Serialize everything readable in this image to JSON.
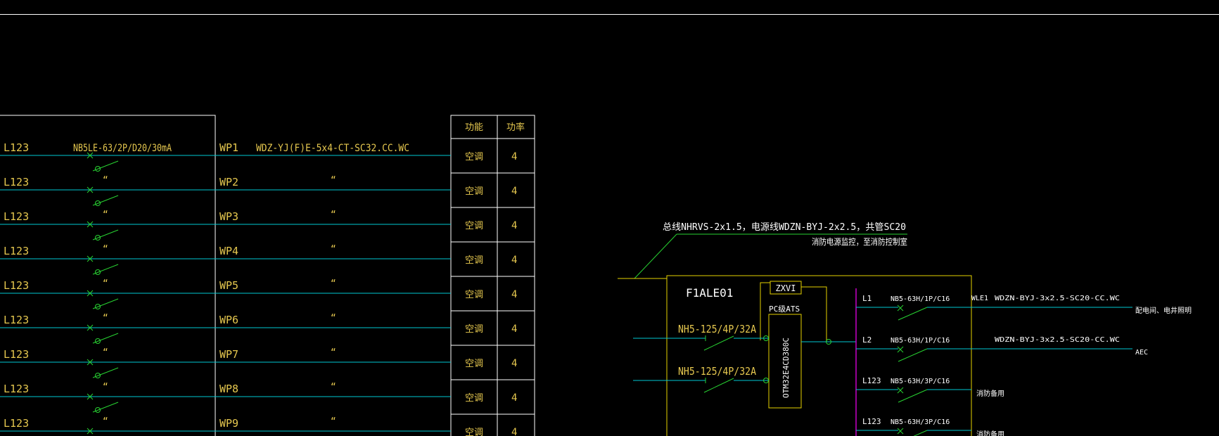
{
  "colors": {
    "background": "#000000",
    "frame": "#ffffff",
    "text": "#e6c84f",
    "feeder": "#00c8d2",
    "switch": "#28d232",
    "panel": "#e6d200",
    "bus": "#c800c8"
  },
  "left_panel": {
    "breaker_spec": "NB5LE-63/2P/D20/30mA",
    "cable_spec": "WDZ-YJ(F)E-5x4-CT-SC32.CC.WC",
    "ditto_mark": "“",
    "rows": [
      {
        "phase": "L123",
        "circuit": "WP1"
      },
      {
        "phase": "L123",
        "circuit": "WP2"
      },
      {
        "phase": "L123",
        "circuit": "WP3"
      },
      {
        "phase": "L123",
        "circuit": "WP4"
      },
      {
        "phase": "L123",
        "circuit": "WP5"
      },
      {
        "phase": "L123",
        "circuit": "WP6"
      },
      {
        "phase": "L123",
        "circuit": "WP7"
      },
      {
        "phase": "L123",
        "circuit": "WP8"
      },
      {
        "phase": "L123",
        "circuit": "WP9"
      }
    ],
    "load_table": {
      "headers": [
        "功能",
        "功率"
      ],
      "rows": [
        {
          "function": "空调",
          "power": "4"
        },
        {
          "function": "空调",
          "power": "4"
        },
        {
          "function": "空调",
          "power": "4"
        },
        {
          "function": "空调",
          "power": "4"
        },
        {
          "function": "空调",
          "power": "4"
        },
        {
          "function": "空调",
          "power": "4"
        },
        {
          "function": "空调",
          "power": "4"
        },
        {
          "function": "空调",
          "power": "4"
        },
        {
          "function": "空调",
          "power": "4"
        }
      ]
    }
  },
  "right_panel": {
    "monitor_note_1": "总线NHRVS-2x1.5，电源线WDZN-BYJ-2x2.5，共管SC20",
    "monitor_note_2": "消防电源监控，至消防控制室",
    "panel_name": "F1ALE01",
    "zxvi_label": "ZXVI",
    "ats_label": "PC级ATS",
    "ats_model": "OTM32E4CD380C",
    "incoming": [
      {
        "breaker": "NH5-125/4P/32A"
      },
      {
        "breaker": "NH5-125/4P/32A"
      }
    ],
    "outgoing": [
      {
        "phase": "L1",
        "breaker": "NB5-63H/1P/C16",
        "circuit": "WLE1",
        "cable": "WDZN-BYJ-3x2.5-SC20-CC.WC",
        "load": "配电间、电井照明"
      },
      {
        "phase": "L2",
        "breaker": "NB5-63H/1P/C16",
        "circuit": "",
        "cable": "WDZN-BYJ-3x2.5-SC20-CC.WC",
        "load": "AEC"
      },
      {
        "phase": "L123",
        "breaker": "NB5-63H/3P/C16",
        "circuit": "",
        "cable": "",
        "load": "消防备用"
      },
      {
        "phase": "L123",
        "breaker": "NB5-63H/3P/C16",
        "circuit": "",
        "cable": "",
        "load": "消防备用"
      }
    ]
  }
}
